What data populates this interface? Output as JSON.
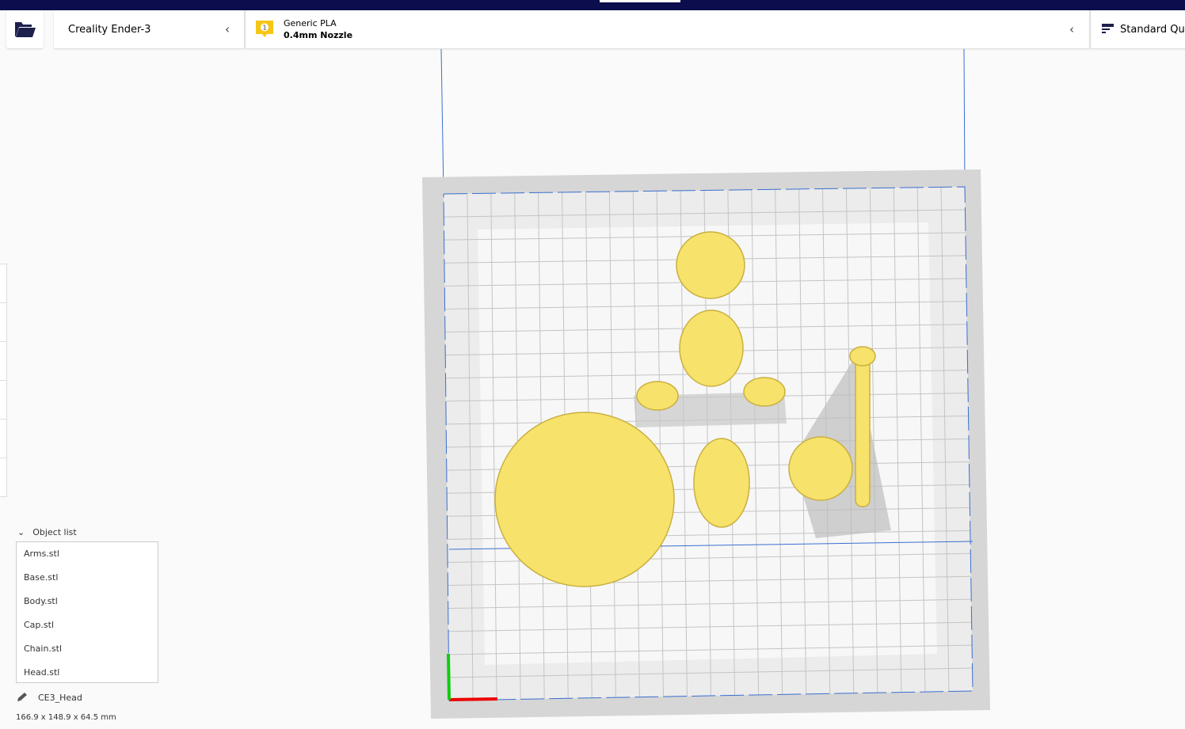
{
  "header": {
    "open_icon": "folder-open-icon",
    "printer_name": "Creality Ender-3",
    "material": {
      "extruder_number": "1",
      "name": "Generic PLA",
      "nozzle": "0.4mm Nozzle"
    },
    "quality": "Standard Qua"
  },
  "object_list": {
    "title": "Object list",
    "items": [
      "Arms.stl",
      "Base.stl",
      "Body.stl",
      "Cap.stl",
      "Chain.stl",
      "Head.stl"
    ]
  },
  "selection": {
    "name": "CE3_Head",
    "dimensions": "166.9 x 148.9 x 64.5 mm"
  },
  "colors": {
    "topbar": "#0c0d4d",
    "model": "#f7e26b",
    "extruder_badge": "#f5c518"
  }
}
